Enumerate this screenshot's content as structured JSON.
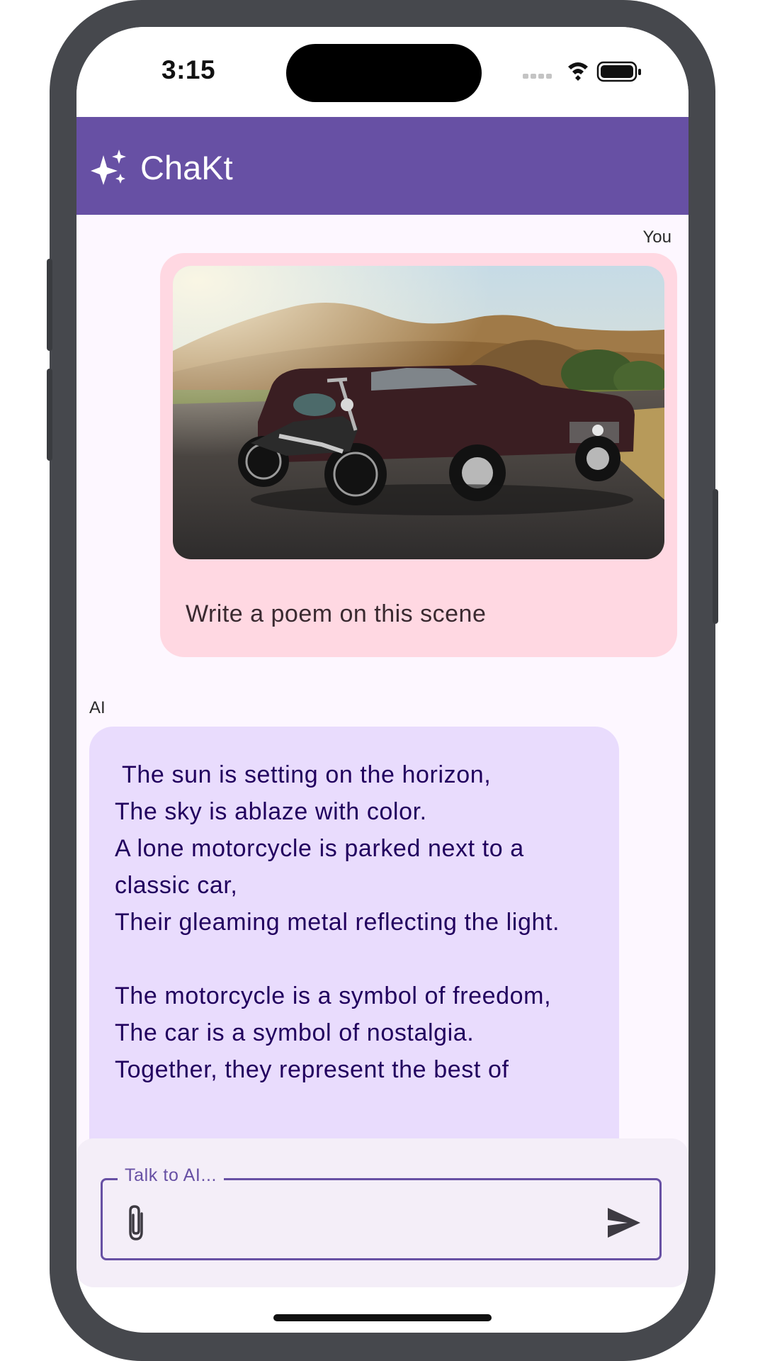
{
  "status_bar": {
    "time": "3:15"
  },
  "app_bar": {
    "title": "ChaKt",
    "icon": "sparkle-icon"
  },
  "chat": {
    "messages": [
      {
        "sender": "You",
        "image": "photo of a motorcycle parked next to a classic car at sunset",
        "text": "Write a poem on this scene"
      },
      {
        "sender": "AI",
        "text": " The sun is setting on the horizon,\nThe sky is ablaze with color.\nA lone motorcycle is parked next to a classic car,\nTheir gleaming metal reflecting the light.\n\nThe motorcycle is a symbol of freedom,\nThe car is a symbol of nostalgia.\nTogether, they represent the best of"
      }
    ]
  },
  "input": {
    "label": "Talk to AI...",
    "value": "",
    "attach_icon": "paperclip-icon",
    "send_icon": "send-icon"
  },
  "colors": {
    "primary": "#6750a4",
    "user_bubble": "#ffd8e2",
    "ai_bubble": "#e9dcfd",
    "background": "#fdf7ff",
    "frame": "#46484d"
  }
}
